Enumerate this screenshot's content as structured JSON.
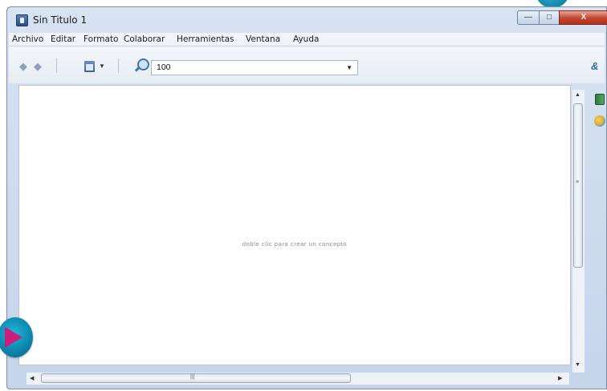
{
  "window": {
    "title": "Sin Titulo 1",
    "controls": {
      "minimize": "—",
      "maximize": "□",
      "close": "X"
    }
  },
  "menu": [
    "Archivo",
    "Editar",
    "Formato",
    "Colaborar",
    "Herramientas",
    "Ventana",
    "Ayuda"
  ],
  "toolbar": {
    "back_icon": "arrow-left-icon",
    "forward_icon": "arrow-right-icon",
    "view_icon": "calendar-view-icon",
    "zoom_icon": "magnifier-icon",
    "zoom_value": "100",
    "right_icon": "collaborate-icon"
  },
  "canvas": {
    "hint": "doble clic para crear un concepto"
  },
  "colors": {
    "play_button": "#0b8fb7",
    "play_triangle": "#cc1f7a",
    "close": "#c4432c"
  }
}
